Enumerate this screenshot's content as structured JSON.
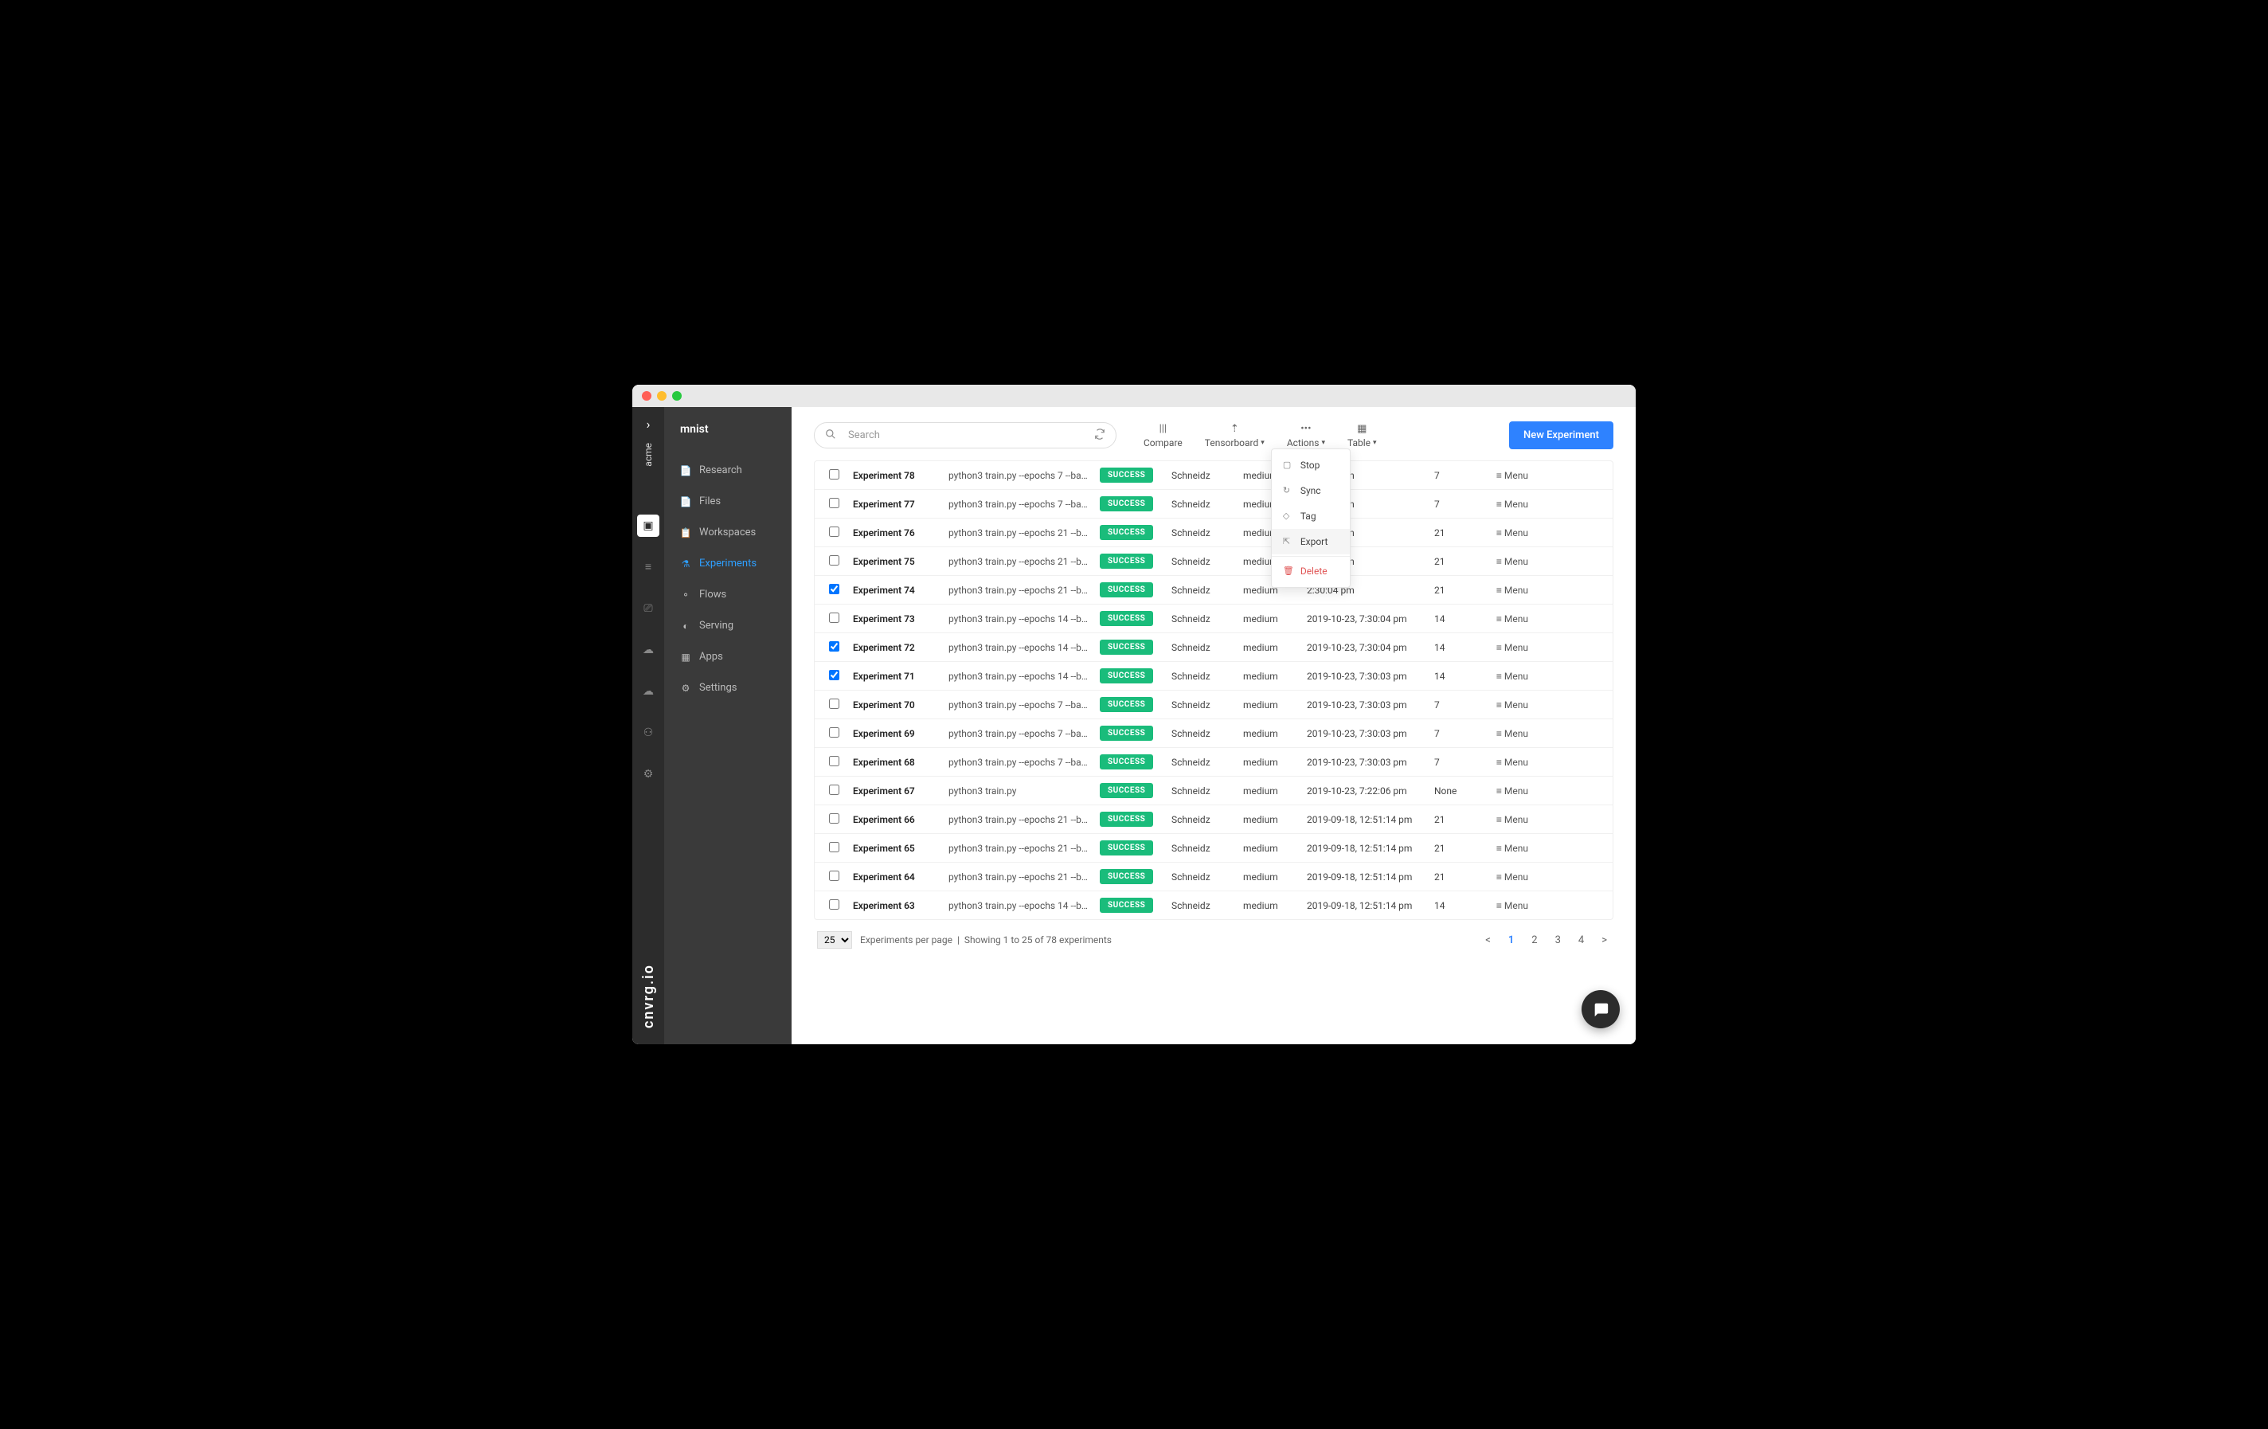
{
  "org": "acme",
  "logo": "cnvrg.io",
  "sidebar": {
    "title": "mnist",
    "items": [
      {
        "label": "Research",
        "icon": "📄"
      },
      {
        "label": "Files",
        "icon": "📄"
      },
      {
        "label": "Workspaces",
        "icon": "📋"
      },
      {
        "label": "Experiments",
        "icon": "⚗"
      },
      {
        "label": "Flows",
        "icon": "⚬"
      },
      {
        "label": "Serving",
        "icon": "◐"
      },
      {
        "label": "Apps",
        "icon": "▦"
      },
      {
        "label": "Settings",
        "icon": "⚙"
      }
    ],
    "active_index": 3
  },
  "toolbar": {
    "search_placeholder": "Search",
    "compare_label": "Compare",
    "tensorboard_label": "Tensorboard",
    "actions_label": "Actions",
    "table_label": "Table",
    "new_experiment_label": "New Experiment"
  },
  "actions_dropdown": {
    "items": [
      {
        "label": "Stop",
        "icon": "▢",
        "danger": false
      },
      {
        "label": "Sync",
        "icon": "↻",
        "danger": false
      },
      {
        "label": "Tag",
        "icon": "◇",
        "danger": false
      },
      {
        "label": "Export",
        "icon": "⇱",
        "danger": false,
        "hover": true
      },
      {
        "label": "Delete",
        "icon": "🗑",
        "danger": true,
        "separator_before": true
      }
    ]
  },
  "table": {
    "menu_label": "Menu",
    "status_success": "SUCCESS",
    "rows": [
      {
        "name": "Experiment 78",
        "cmd": "python3 train.py --epochs 7 --batch_...",
        "user": "Schneidz",
        "compute": "medium",
        "time": "2:33:31 pm",
        "col": "7",
        "checked": false
      },
      {
        "name": "Experiment 77",
        "cmd": "python3 train.py --epochs 7 --batch_...",
        "user": "Schneidz",
        "compute": "medium",
        "time": "2:33:31 pm",
        "col": "7",
        "checked": false
      },
      {
        "name": "Experiment 76",
        "cmd": "python3 train.py --epochs 21 --batch...",
        "user": "Schneidz",
        "compute": "medium",
        "time": "2:30:04 pm",
        "col": "21",
        "checked": false
      },
      {
        "name": "Experiment 75",
        "cmd": "python3 train.py --epochs 21 --batch...",
        "user": "Schneidz",
        "compute": "medium",
        "time": "2:30:04 pm",
        "col": "21",
        "checked": false
      },
      {
        "name": "Experiment 74",
        "cmd": "python3 train.py --epochs 21 --batch...",
        "user": "Schneidz",
        "compute": "medium",
        "time": "2:30:04 pm",
        "col": "21",
        "checked": true
      },
      {
        "name": "Experiment 73",
        "cmd": "python3 train.py --epochs 14 --batch...",
        "user": "Schneidz",
        "compute": "medium",
        "time": "2019-10-23, 7:30:04 pm",
        "col": "14",
        "checked": false
      },
      {
        "name": "Experiment 72",
        "cmd": "python3 train.py --epochs 14 --batch...",
        "user": "Schneidz",
        "compute": "medium",
        "time": "2019-10-23, 7:30:04 pm",
        "col": "14",
        "checked": true
      },
      {
        "name": "Experiment 71",
        "cmd": "python3 train.py --epochs 14 --batch...",
        "user": "Schneidz",
        "compute": "medium",
        "time": "2019-10-23, 7:30:03 pm",
        "col": "14",
        "checked": true
      },
      {
        "name": "Experiment 70",
        "cmd": "python3 train.py --epochs 7 --batch_...",
        "user": "Schneidz",
        "compute": "medium",
        "time": "2019-10-23, 7:30:03 pm",
        "col": "7",
        "checked": false
      },
      {
        "name": "Experiment 69",
        "cmd": "python3 train.py --epochs 7 --batch_...",
        "user": "Schneidz",
        "compute": "medium",
        "time": "2019-10-23, 7:30:03 pm",
        "col": "7",
        "checked": false
      },
      {
        "name": "Experiment 68",
        "cmd": "python3 train.py --epochs 7 --batch_...",
        "user": "Schneidz",
        "compute": "medium",
        "time": "2019-10-23, 7:30:03 pm",
        "col": "7",
        "checked": false
      },
      {
        "name": "Experiment 67",
        "cmd": "python3 train.py",
        "user": "Schneidz",
        "compute": "medium",
        "time": "2019-10-23, 7:22:06 pm",
        "col": "None",
        "checked": false
      },
      {
        "name": "Experiment 66",
        "cmd": "python3 train.py --epochs 21 --batch...",
        "user": "Schneidz",
        "compute": "medium",
        "time": "2019-09-18, 12:51:14 pm",
        "col": "21",
        "checked": false
      },
      {
        "name": "Experiment 65",
        "cmd": "python3 train.py --epochs 21 --batch...",
        "user": "Schneidz",
        "compute": "medium",
        "time": "2019-09-18, 12:51:14 pm",
        "col": "21",
        "checked": false
      },
      {
        "name": "Experiment 64",
        "cmd": "python3 train.py --epochs 21 --batch...",
        "user": "Schneidz",
        "compute": "medium",
        "time": "2019-09-18, 12:51:14 pm",
        "col": "21",
        "checked": false
      },
      {
        "name": "Experiment 63",
        "cmd": "python3 train.py --epochs 14 --batch...",
        "user": "Schneidz",
        "compute": "medium",
        "time": "2019-09-18, 12:51:14 pm",
        "col": "14",
        "checked": false
      }
    ]
  },
  "footer": {
    "per_page": "25",
    "per_page_label": "Experiments per page",
    "range_text": "Showing 1 to 25 of 78 experiments",
    "pages": [
      "<",
      "1",
      "2",
      "3",
      "4",
      ">"
    ],
    "active_page_index": 1
  }
}
